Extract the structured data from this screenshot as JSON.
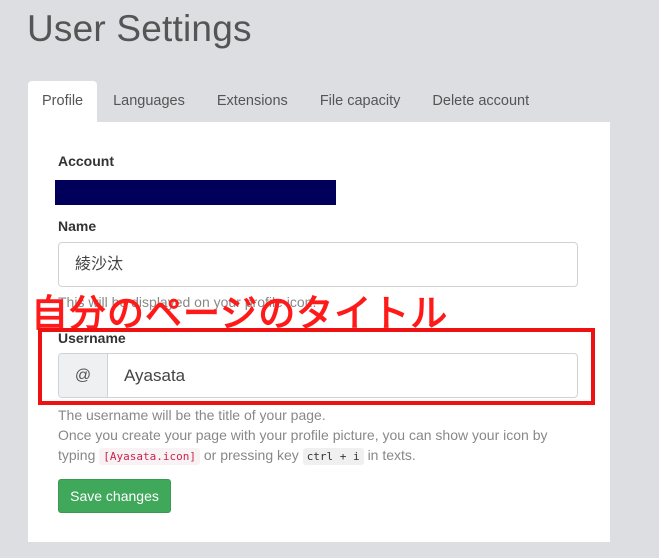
{
  "page": {
    "title": "User Settings"
  },
  "tabs": [
    {
      "label": "Profile",
      "active": true
    },
    {
      "label": "Languages",
      "active": false
    },
    {
      "label": "Extensions",
      "active": false
    },
    {
      "label": "File capacity",
      "active": false
    },
    {
      "label": "Delete account",
      "active": false
    }
  ],
  "profile": {
    "account_label": "Account",
    "name_label": "Name",
    "name_value": "綾沙汰",
    "name_help": "This will be displayed on your profile icon.",
    "username_label": "Username",
    "username_prefix": "@",
    "username_value": "Ayasata",
    "desc_line1": "The username will be the title of your page.",
    "desc_line2": "Once you create your page with your profile picture, you can show your icon by",
    "desc_typing": "typing",
    "desc_code": "[Ayasata.icon]",
    "desc_or": "or pressing key",
    "desc_key": "ctrl + i",
    "desc_end": "in texts.",
    "save_label": "Save changes"
  },
  "annotation": {
    "text": "自分のページのタイトル",
    "color": "#ff1a1a"
  },
  "colors": {
    "background": "#dddee2",
    "account_redaction": "#00005a",
    "save_button": "#3fa85b"
  }
}
